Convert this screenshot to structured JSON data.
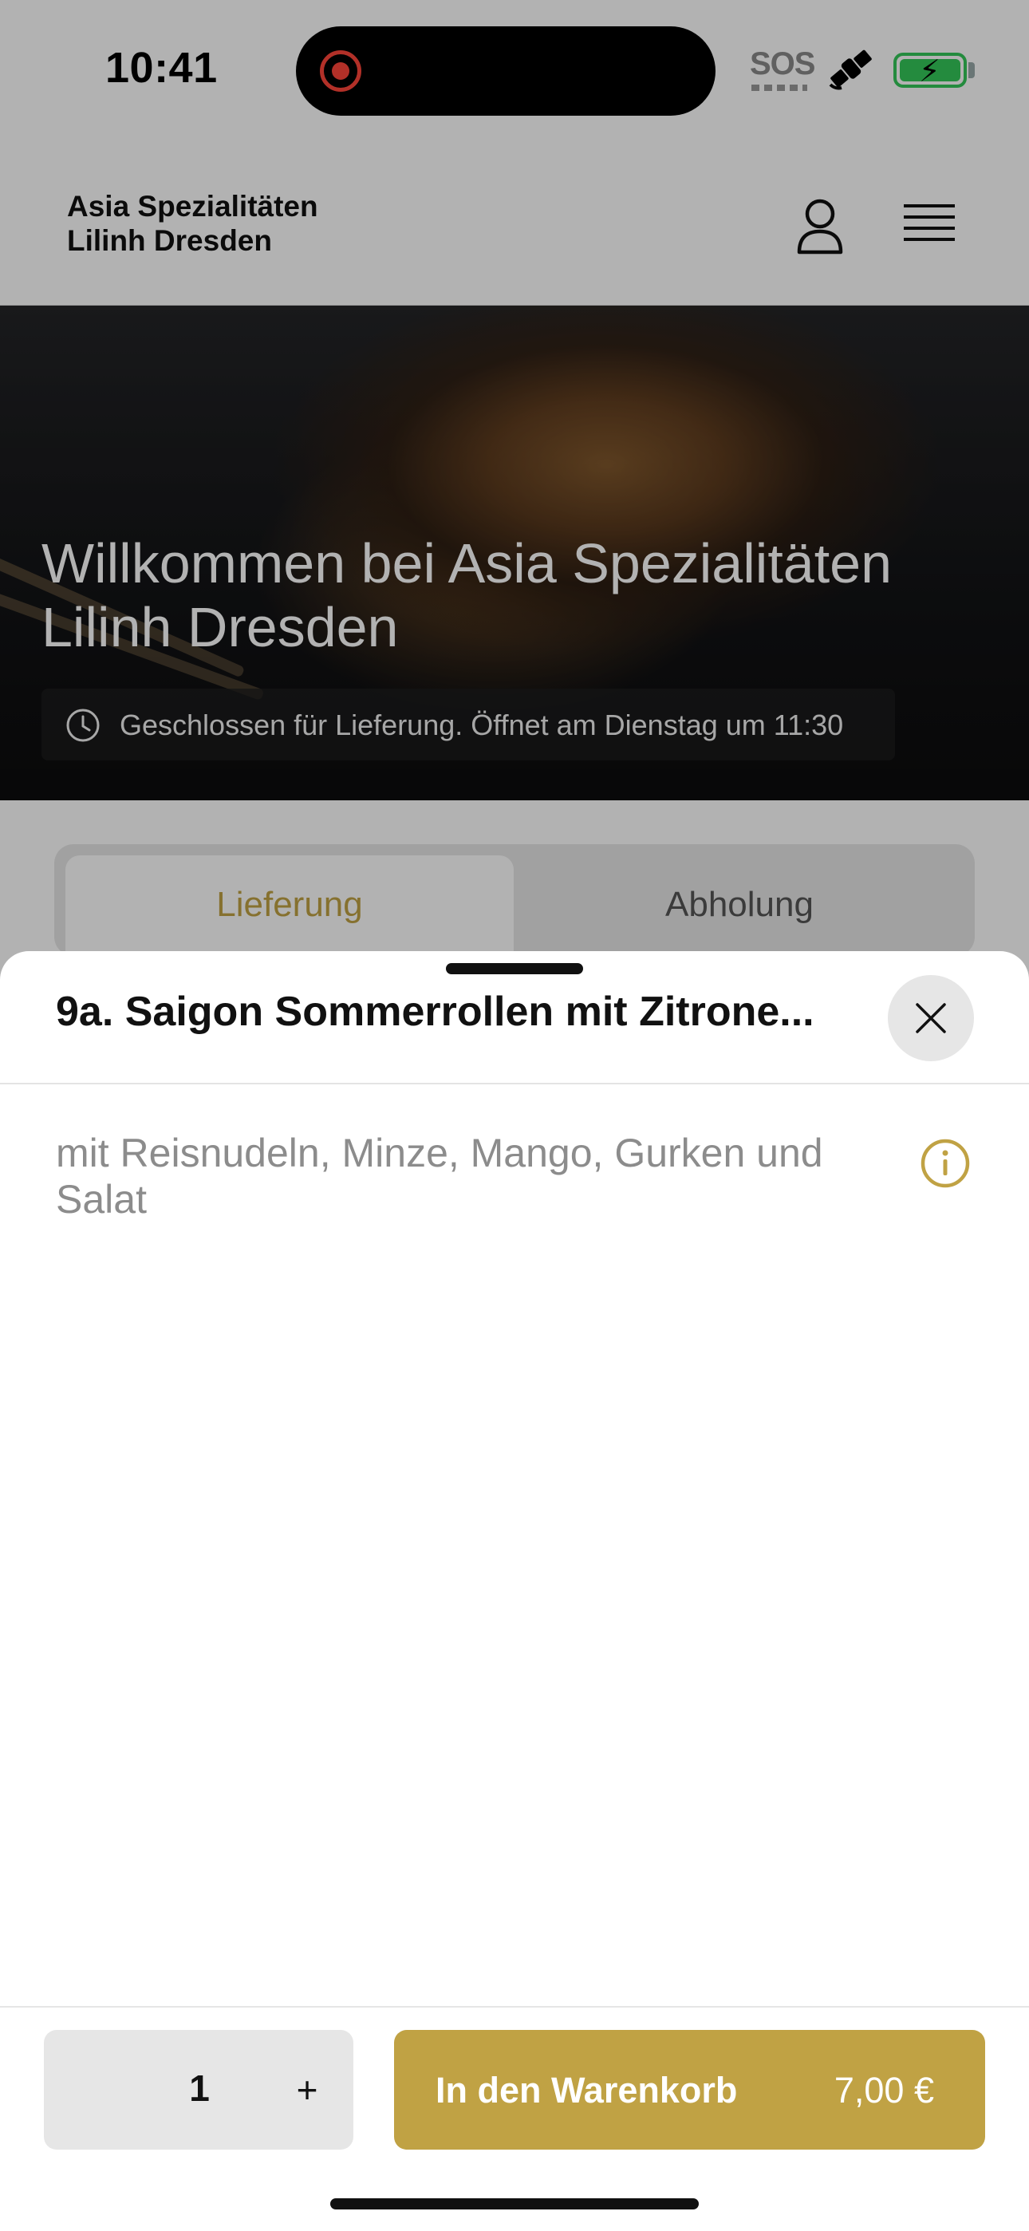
{
  "status_bar": {
    "time": "10:41",
    "sos": "SOS"
  },
  "header": {
    "site_name": "Asia Spezialitäten Lilinh Dresden"
  },
  "hero": {
    "title": "Willkommen bei Asia Spezialitäten Lilinh Dresden",
    "status_text": "Geschlossen für Lieferung. Öffnet am Dienstag um 11:30"
  },
  "tabs": [
    {
      "label": "Lieferung",
      "active": true
    },
    {
      "label": "Abholung",
      "active": false
    }
  ],
  "sheet": {
    "title": "9a. Saigon Sommerrollen mit Zitrone...",
    "description": "mit Reisnudeln, Minze, Mango, Gurken und Salat"
  },
  "footer": {
    "quantity": "1",
    "plus": "+",
    "cart_label": "In den Warenkorb",
    "price": "7,00 €"
  },
  "colors": {
    "accent": "#c0a244",
    "sheet_bg": "#ffffff",
    "battery": "#34c759",
    "record": "#ff453a"
  },
  "icons": [
    "record-icon",
    "satellite-icon",
    "battery-icon",
    "user-icon",
    "menu-icon",
    "clock-icon",
    "close-icon",
    "info-icon",
    "plus-icon"
  ]
}
